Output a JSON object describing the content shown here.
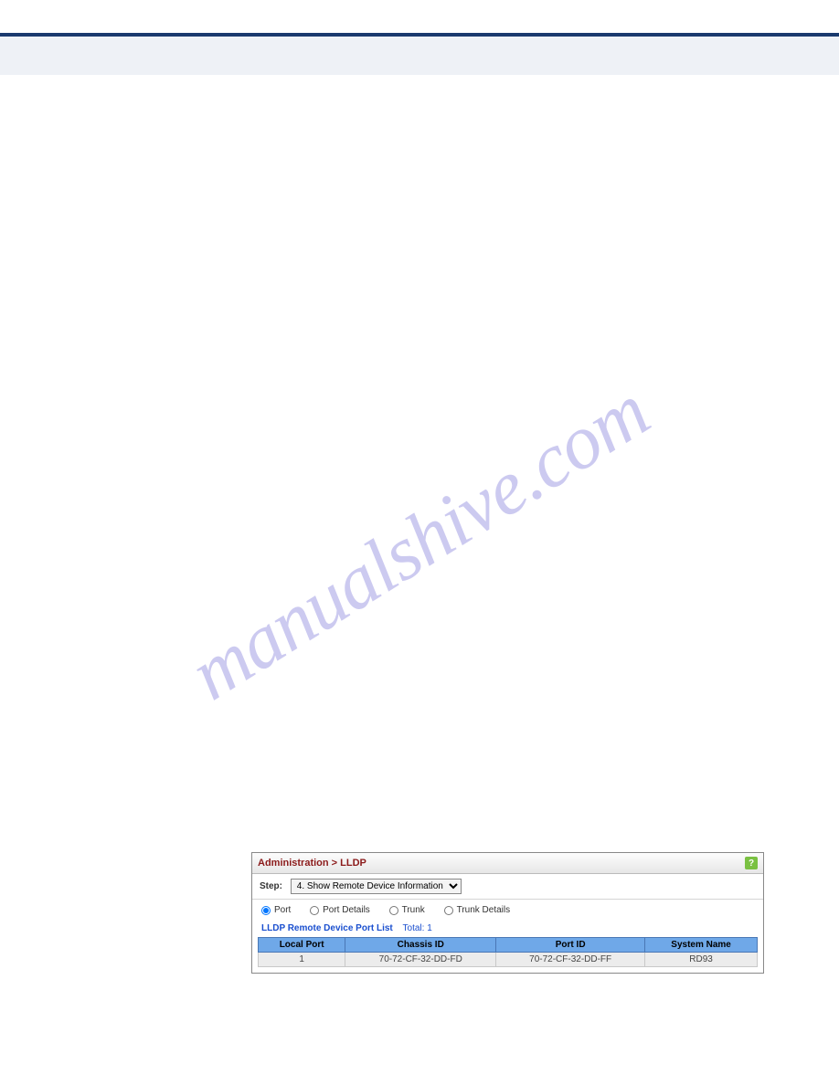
{
  "watermark": "manualshive.com",
  "panel": {
    "breadcrumb": "Administration > LLDP",
    "help_glyph": "?",
    "step_label": "Step:",
    "step_value": "4. Show Remote Device Information",
    "radios": {
      "port": "Port",
      "port_details": "Port Details",
      "trunk": "Trunk",
      "trunk_details": "Trunk Details"
    },
    "list_title": "LLDP Remote Device Port List",
    "list_total_label": "Total:",
    "list_total_value": "1",
    "columns": {
      "local_port": "Local Port",
      "chassis_id": "Chassis ID",
      "port_id": "Port ID",
      "system_name": "System Name"
    },
    "rows": [
      {
        "local_port": "1",
        "chassis_id": "70-72-CF-32-DD-FD",
        "port_id": "70-72-CF-32-DD-FF",
        "system_name": "RD93"
      }
    ]
  }
}
